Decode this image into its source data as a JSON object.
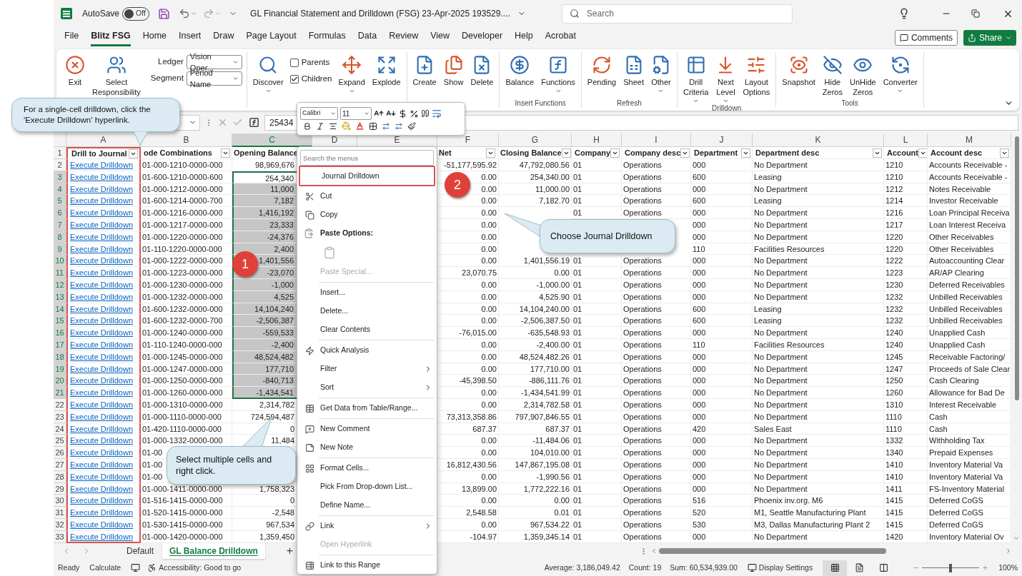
{
  "title_bar": {
    "autosave_label": "AutoSave",
    "autosave": {
      "label": "Off",
      "on": false
    },
    "title": "GL Financial Statement and Drilldown (FSG) 23-Apr-2025 193529....",
    "search": {
      "placeholder": "Search"
    }
  },
  "menu_tabs": [
    {
      "label": "File",
      "selected": false
    },
    {
      "label": "Blitz FSG",
      "selected": true
    },
    {
      "label": "Home",
      "selected": false
    },
    {
      "label": "Insert",
      "selected": false
    },
    {
      "label": "Draw",
      "selected": false
    },
    {
      "label": "Page Layout",
      "selected": false
    },
    {
      "label": "Formulas",
      "selected": false
    },
    {
      "label": "Data",
      "selected": false
    },
    {
      "label": "Review",
      "selected": false
    },
    {
      "label": "View",
      "selected": false
    },
    {
      "label": "Developer",
      "selected": false
    },
    {
      "label": "Help",
      "selected": false
    },
    {
      "label": "Acrobat",
      "selected": false
    }
  ],
  "comments_button": "Comments",
  "share_button": "Share",
  "ribbon": {
    "groups": [
      {
        "items": [
          {
            "kind": "button",
            "label": "Exit",
            "dropdown": false
          },
          {
            "kind": "button",
            "label": "Select Responsibility",
            "dropdown": false
          },
          {
            "kind": "selects",
            "rows": [
              {
                "label": "Ledger",
                "value": "Vision Oper..."
              },
              {
                "label": "Segment",
                "value": "Period Name"
              }
            ]
          }
        ]
      },
      {
        "items": [
          {
            "kind": "button",
            "label": "Discover",
            "dropdown": true
          },
          {
            "kind": "checks",
            "rows": [
              {
                "label": "Parents",
                "checked": false
              },
              {
                "label": "Children",
                "checked": true
              }
            ]
          },
          {
            "kind": "button",
            "label": "Expand",
            "dropdown": true
          },
          {
            "kind": "button",
            "label": "Explode",
            "dropdown": false
          }
        ]
      },
      {
        "items": [
          {
            "kind": "button",
            "label": "Create",
            "dropdown": false
          },
          {
            "kind": "button",
            "label": "Show",
            "dropdown": false
          },
          {
            "kind": "button",
            "label": "Delete",
            "dropdown": false
          }
        ]
      },
      {
        "label": "Insert Functions",
        "items": [
          {
            "kind": "button",
            "label": "Balance",
            "dropdown": false
          },
          {
            "kind": "button",
            "label": "Functions",
            "dropdown": true
          }
        ]
      },
      {
        "label": "Refresh",
        "items": [
          {
            "kind": "button",
            "label": "Pending",
            "dropdown": false
          },
          {
            "kind": "button",
            "label": "Sheet",
            "dropdown": false
          },
          {
            "kind": "button",
            "label": "Other",
            "dropdown": true
          }
        ]
      },
      {
        "label": "Drilldown",
        "items": [
          {
            "kind": "button",
            "label": "Drill Criteria",
            "dropdown": true
          },
          {
            "kind": "button",
            "label": "Next Level",
            "dropdown": true
          },
          {
            "kind": "button",
            "label": "Layout Options",
            "dropdown": false
          }
        ]
      },
      {
        "label": "Tools",
        "items": [
          {
            "kind": "button",
            "label": "Snapshot",
            "dropdown": false
          },
          {
            "kind": "button",
            "label": "Hide Zeros",
            "dropdown": false
          },
          {
            "kind": "button",
            "label": "UnHide Zeros",
            "dropdown": false
          },
          {
            "kind": "button",
            "label": "Converter",
            "dropdown": true
          }
        ]
      }
    ]
  },
  "formula_bar": {
    "value": "25434"
  },
  "mini_toolbar": {
    "font": "Calibri",
    "size": "11"
  },
  "columns": [
    {
      "letter": "A",
      "header": "Drill to Journal",
      "filter": true
    },
    {
      "letter": "B",
      "header": "ode Combinations",
      "filter": true
    },
    {
      "letter": "C",
      "header": "Opening Balance",
      "filter": false
    },
    {
      "letter": "D"
    },
    {
      "letter": "E"
    },
    {
      "letter": "F",
      "header": "Net",
      "filter": true
    },
    {
      "letter": "G",
      "header": "Closing Balance",
      "filter": true
    },
    {
      "letter": "H",
      "header": "Company",
      "filter": true
    },
    {
      "letter": "I",
      "header": "Company desc",
      "filter": true
    },
    {
      "letter": "J",
      "header": "Department",
      "filter": true
    },
    {
      "letter": "K",
      "header": "Department desc",
      "filter": true
    },
    {
      "letter": "L",
      "header": "Account",
      "filter": true
    },
    {
      "letter": "M",
      "header": "Account desc",
      "filter": true
    }
  ],
  "header_row_number": "1",
  "rows": [
    {
      "num": "2",
      "selected": false,
      "cells": [
        "Execute Drilldown",
        "01-000-1210-0000-000",
        "98,969,676",
        null,
        null,
        "-51,177,595.92",
        "47,792,080.56",
        "01",
        "Operations",
        "000",
        "No Department",
        "1210",
        "Accounts Receivable -"
      ]
    },
    {
      "num": "3",
      "selected": true,
      "cells": [
        "Execute Drilldown",
        "01-600-1210-0000-600",
        "254,340",
        null,
        null,
        "0.00",
        "254,340.00",
        "01",
        "Operations",
        "600",
        "Leasing",
        "1210",
        "Accounts Receivable -"
      ]
    },
    {
      "num": "4",
      "selected": true,
      "cells": [
        "Execute Drilldown",
        "01-000-1212-0000-000",
        "11,000",
        null,
        null,
        "0.00",
        "11,000.00",
        "01",
        "Operations",
        "000",
        "No Department",
        "1212",
        "Notes Receivable"
      ]
    },
    {
      "num": "5",
      "selected": true,
      "cells": [
        "Execute Drilldown",
        "01-600-1214-0000-700",
        "7,182",
        null,
        null,
        "0.00",
        "7,182.70",
        "01",
        "Operations",
        "600",
        "Leasing",
        "1214",
        "Investor Receivable"
      ]
    },
    {
      "num": "6",
      "selected": true,
      "cells": [
        "Execute Drilldown",
        "01-000-1216-0000-000",
        "1,416,192",
        null,
        null,
        "0.00",
        null,
        "01",
        "Operations",
        "000",
        "No Department",
        "1216",
        "Loan Principal Receiva"
      ]
    },
    {
      "num": "7",
      "selected": true,
      "cells": [
        "Execute Drilldown",
        "01-000-1217-0000-000",
        "23,333",
        null,
        null,
        "0.00",
        null,
        null,
        null,
        "000",
        "No Department",
        "1217",
        "Loan Interest Receiva"
      ]
    },
    {
      "num": "8",
      "selected": true,
      "cells": [
        "Execute Drilldown",
        "01-000-1220-0000-000",
        "-24,376",
        null,
        null,
        "0.00",
        null,
        null,
        null,
        "000",
        "No Department",
        "1220",
        "Other Receivables"
      ]
    },
    {
      "num": "9",
      "selected": true,
      "cells": [
        "Execute Drilldown",
        "01-110-1220-0000-000",
        "2,400",
        null,
        null,
        "0.00",
        null,
        null,
        null,
        "110",
        "Facilities Resources",
        "1220",
        "Other Receivables"
      ]
    },
    {
      "num": "10",
      "selected": true,
      "cells": [
        "Execute Drilldown",
        "01-000-1222-0000-000",
        "1,401,556",
        null,
        null,
        "0.00",
        "1,401,556.19",
        "01",
        "Operations",
        "000",
        "No Department",
        "1222",
        "Autoaccounting Clear"
      ]
    },
    {
      "num": "11",
      "selected": true,
      "cells": [
        "Execute Drilldown",
        "01-000-1223-0000-000",
        "-23,070",
        null,
        null,
        "23,070.75",
        "0.00",
        "01",
        "Operations",
        "000",
        "No Department",
        "1223",
        "AR/AP Clearing"
      ]
    },
    {
      "num": "12",
      "selected": true,
      "cells": [
        "Execute Drilldown",
        "01-000-1230-0000-000",
        "-1,000",
        null,
        null,
        "0.00",
        "-1,000.00",
        "01",
        "Operations",
        "000",
        "No Department",
        "1230",
        "Deferred Receivables"
      ]
    },
    {
      "num": "13",
      "selected": true,
      "cells": [
        "Execute Drilldown",
        "01-000-1232-0000-000",
        "4,525",
        null,
        null,
        "0.00",
        "4,525.90",
        "01",
        "Operations",
        "000",
        "No Department",
        "1232",
        "Unbilled Receivables"
      ]
    },
    {
      "num": "14",
      "selected": true,
      "cells": [
        "Execute Drilldown",
        "01-600-1232-0000-000",
        "14,104,240",
        null,
        null,
        "0.00",
        "14,104,240.00",
        "01",
        "Operations",
        "600",
        "Leasing",
        "1232",
        "Unbilled Receivables"
      ]
    },
    {
      "num": "15",
      "selected": true,
      "cells": [
        "Execute Drilldown",
        "01-600-1232-0000-700",
        "-2,506,387",
        null,
        null,
        "0.00",
        "-2,506,387.50",
        "01",
        "Operations",
        "600",
        "Leasing",
        "1232",
        "Unbilled Receivables"
      ]
    },
    {
      "num": "16",
      "selected": true,
      "cells": [
        "Execute Drilldown",
        "01-000-1240-0000-000",
        "-559,533",
        null,
        null,
        "-76,015.00",
        "-635,548.93",
        "01",
        "Operations",
        "000",
        "No Department",
        "1240",
        "Unapplied Cash"
      ]
    },
    {
      "num": "17",
      "selected": true,
      "cells": [
        "Execute Drilldown",
        "01-110-1240-0000-000",
        "-2,400",
        null,
        null,
        "0.00",
        "-2,400.00",
        "01",
        "Operations",
        "110",
        "Facilities Resources",
        "1240",
        "Unapplied Cash"
      ]
    },
    {
      "num": "18",
      "selected": true,
      "cells": [
        "Execute Drilldown",
        "01-000-1245-0000-000",
        "48,524,482",
        null,
        null,
        "0.00",
        "48,524,482.26",
        "01",
        "Operations",
        "000",
        "No Department",
        "1245",
        "Receivable Factoring/"
      ]
    },
    {
      "num": "19",
      "selected": true,
      "cells": [
        "Execute Drilldown",
        "01-000-1247-0000-000",
        "177,710",
        null,
        null,
        "0.00",
        "177,710.00",
        "01",
        "Operations",
        "000",
        "No Department",
        "1247",
        "Proceeds of Sale Clear"
      ]
    },
    {
      "num": "20",
      "selected": true,
      "cells": [
        "Execute Drilldown",
        "01-000-1250-0000-000",
        "-840,713",
        null,
        null,
        "-45,398.50",
        "-886,111.76",
        "01",
        "Operations",
        "000",
        "No Department",
        "1250",
        "Cash Clearing"
      ]
    },
    {
      "num": "21",
      "selected": true,
      "cells": [
        "Execute Drilldown",
        "01-000-1260-0000-000",
        "-1,434,541",
        null,
        null,
        "0.00",
        "-1,434,541.99",
        "01",
        "Operations",
        "000",
        "No Department",
        "1260",
        "Allowance for Bad De"
      ]
    },
    {
      "num": "22",
      "selected": false,
      "cells": [
        "Execute Drilldown",
        "01-000-1310-0000-000",
        "2,314,782",
        null,
        null,
        "0.00",
        "2,314,782.58",
        "01",
        "Operations",
        "000",
        "No Department",
        "1310",
        "Interest Receivable"
      ]
    },
    {
      "num": "23",
      "selected": false,
      "cells": [
        "Execute Drilldown",
        "01-000-1110-0000-000",
        "724,594,487",
        null,
        null,
        "73,313,358.86",
        "797,907,846.55",
        "01",
        "Operations",
        "000",
        "No Department",
        "1110",
        "Cash"
      ]
    },
    {
      "num": "24",
      "selected": false,
      "cells": [
        "Execute Drilldown",
        "01-420-1110-0000-000",
        "0",
        null,
        null,
        "687.37",
        "687.37",
        "01",
        "Operations",
        "420",
        "Sales East",
        "1110",
        "Cash"
      ]
    },
    {
      "num": "25",
      "selected": false,
      "cells": [
        "Execute Drilldown",
        "01-000-1332-0000-000",
        "11,484",
        null,
        null,
        "0.00",
        "-11,484.06",
        "01",
        "Operations",
        "000",
        "No Department",
        "1332",
        "Withholding Tax"
      ]
    },
    {
      "num": "26",
      "selected": false,
      "cells": [
        "Execute Drilldown",
        "01-00",
        null,
        null,
        null,
        "0.00",
        "104,010.00",
        "01",
        "Operations",
        "000",
        "No Department",
        "1340",
        "Prepaid Expenses"
      ]
    },
    {
      "num": "27",
      "selected": false,
      "cells": [
        "Execute Drilldown",
        "01-00",
        null,
        null,
        null,
        "16,812,430.56",
        "147,867,195.08",
        "01",
        "Operations",
        "000",
        "No Department",
        "1410",
        "Inventory Material Va"
      ]
    },
    {
      "num": "28",
      "selected": false,
      "cells": [
        "Execute Drilldown",
        "01-00",
        null,
        null,
        null,
        "0.00",
        "-1,990.56",
        "01",
        "Operations",
        "000",
        "No Department",
        "1410",
        "Inventory Material Va"
      ]
    },
    {
      "num": "29",
      "selected": false,
      "cells": [
        "Execute Drilldown",
        "01-000-1411-0000-000",
        "1,758,323",
        null,
        null,
        "13,899.00",
        "1,772,222.16",
        "01",
        "Operations",
        "000",
        "No Department",
        "1411",
        "FS-Inventory Material"
      ]
    },
    {
      "num": "30",
      "selected": false,
      "cells": [
        "Execute Drilldown",
        "01-516-1415-0000-000",
        "0",
        null,
        null,
        "0.00",
        "0.00",
        "01",
        "Operations",
        "516",
        "Phoenix inv.org. M6",
        "1415",
        "Deferred CoGS"
      ]
    },
    {
      "num": "31",
      "selected": false,
      "cells": [
        "Execute Drilldown",
        "01-520-1415-0000-000",
        "-2,548",
        null,
        null,
        "2,548.58",
        "0.01",
        "01",
        "Operations",
        "520",
        "M1, Seattle Manufacturing Plant",
        "1415",
        "Deferred CoGS"
      ]
    },
    {
      "num": "32",
      "selected": false,
      "cells": [
        "Execute Drilldown",
        "01-530-1415-0000-000",
        "967,534",
        null,
        null,
        "0.00",
        "967,534.22",
        "01",
        "Operations",
        "530",
        "M3, Dallas Manufacturing Plant 2",
        "1415",
        "Deferred CoGS"
      ]
    },
    {
      "num": "33",
      "selected": false,
      "cells": [
        "Execute Drilldown",
        "01-000-1420-0000-000",
        "1,359,450",
        null,
        null,
        "-104.97",
        "1,359,345.14",
        "01",
        "Operations",
        "000",
        "No Department",
        "1420",
        "Inventory Material Ov"
      ]
    }
  ],
  "context_menu": {
    "search": {
      "placeholder": "Search the menus"
    },
    "items": [
      {
        "kind": "item",
        "label": "Journal Drilldown",
        "highlighted": true,
        "disabled": false,
        "submenu": false
      },
      {
        "kind": "item",
        "label": "Cut",
        "highlighted": false,
        "disabled": false,
        "submenu": false
      },
      {
        "kind": "item",
        "label": "Copy",
        "highlighted": false,
        "disabled": false,
        "submenu": false
      },
      {
        "kind": "heading",
        "label": "Paste Options:"
      },
      {
        "kind": "paste"
      },
      {
        "kind": "item",
        "label": "Paste Special...",
        "highlighted": false,
        "disabled": true,
        "submenu": false
      },
      {
        "kind": "separator"
      },
      {
        "kind": "item",
        "label": "Insert...",
        "highlighted": false,
        "disabled": false,
        "submenu": false
      },
      {
        "kind": "item",
        "label": "Delete...",
        "highlighted": false,
        "disabled": false,
        "submenu": false
      },
      {
        "kind": "item",
        "label": "Clear Contents",
        "highlighted": false,
        "disabled": false,
        "submenu": false
      },
      {
        "kind": "separator"
      },
      {
        "kind": "item",
        "label": "Quick Analysis",
        "highlighted": false,
        "disabled": false,
        "submenu": false
      },
      {
        "kind": "item",
        "label": "Filter",
        "highlighted": false,
        "disabled": false,
        "submenu": true
      },
      {
        "kind": "item",
        "label": "Sort",
        "highlighted": false,
        "disabled": false,
        "submenu": true
      },
      {
        "kind": "separator"
      },
      {
        "kind": "item",
        "label": "Get Data from Table/Range...",
        "highlighted": false,
        "disabled": false,
        "submenu": false
      },
      {
        "kind": "separator"
      },
      {
        "kind": "item",
        "label": "New Comment",
        "highlighted": false,
        "disabled": false,
        "submenu": false
      },
      {
        "kind": "item",
        "label": "New Note",
        "highlighted": false,
        "disabled": false,
        "submenu": false
      },
      {
        "kind": "separator"
      },
      {
        "kind": "item",
        "label": "Format Cells...",
        "highlighted": false,
        "disabled": false,
        "submenu": false
      },
      {
        "kind": "item",
        "label": "Pick From Drop-down List...",
        "highlighted": false,
        "disabled": false,
        "submenu": false
      },
      {
        "kind": "item",
        "label": "Define Name...",
        "highlighted": false,
        "disabled": false,
        "submenu": false
      },
      {
        "kind": "separator"
      },
      {
        "kind": "item",
        "label": "Link",
        "highlighted": false,
        "disabled": false,
        "submenu": true
      },
      {
        "kind": "item",
        "label": "Open Hyperlink",
        "highlighted": false,
        "disabled": true,
        "submenu": false
      },
      {
        "kind": "separator"
      },
      {
        "kind": "item",
        "label": "Link to this Range",
        "highlighted": false,
        "disabled": false,
        "submenu": false
      }
    ]
  },
  "callouts": [
    {
      "text": "For a single-cell drilldown, click the 'Execute Drilldown' hyperlink."
    },
    {
      "text": "Choose Journal Drilldown"
    },
    {
      "text": "Select multiple cells and right click."
    }
  ],
  "badges": [
    "1",
    "2"
  ],
  "sheet_tabs": [
    {
      "label": "Default",
      "selected": false
    },
    {
      "label": "GL Balance Drilldown",
      "selected": true
    }
  ],
  "add_sheet": "+",
  "status_bar": {
    "ready": "Ready",
    "calculate": "Calculate",
    "accessibility": "Accessibility: Good to go",
    "average": "Average: 3,186,049.42",
    "count": "Count: 19",
    "sum": "Sum: 60,534,939.00",
    "display_settings": "Display Settings",
    "views": [
      {
        "selected": true
      },
      {
        "selected": false
      },
      {
        "selected": false
      }
    ],
    "zoom": {
      "level": 0.5,
      "reading": "100%"
    }
  }
}
